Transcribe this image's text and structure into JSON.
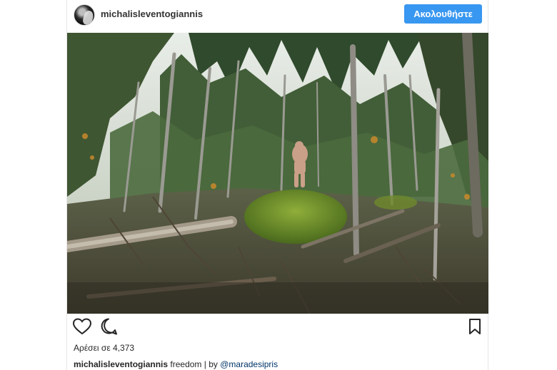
{
  "post": {
    "username": "michalisleventogiannis",
    "follow_label": "Ακολουθήστε",
    "likes_prefix": "Αρέσει σε",
    "likes_count": "4,373",
    "caption_user": "michalisleventogiannis",
    "caption_text": "freedom | by",
    "caption_mention": "@maradesipris"
  },
  "colors": {
    "accent": "#3897f0",
    "text": "#262626"
  },
  "icons": {
    "like": "heart-outline",
    "comment": "speech-bubble-outline",
    "save": "bookmark-outline"
  }
}
